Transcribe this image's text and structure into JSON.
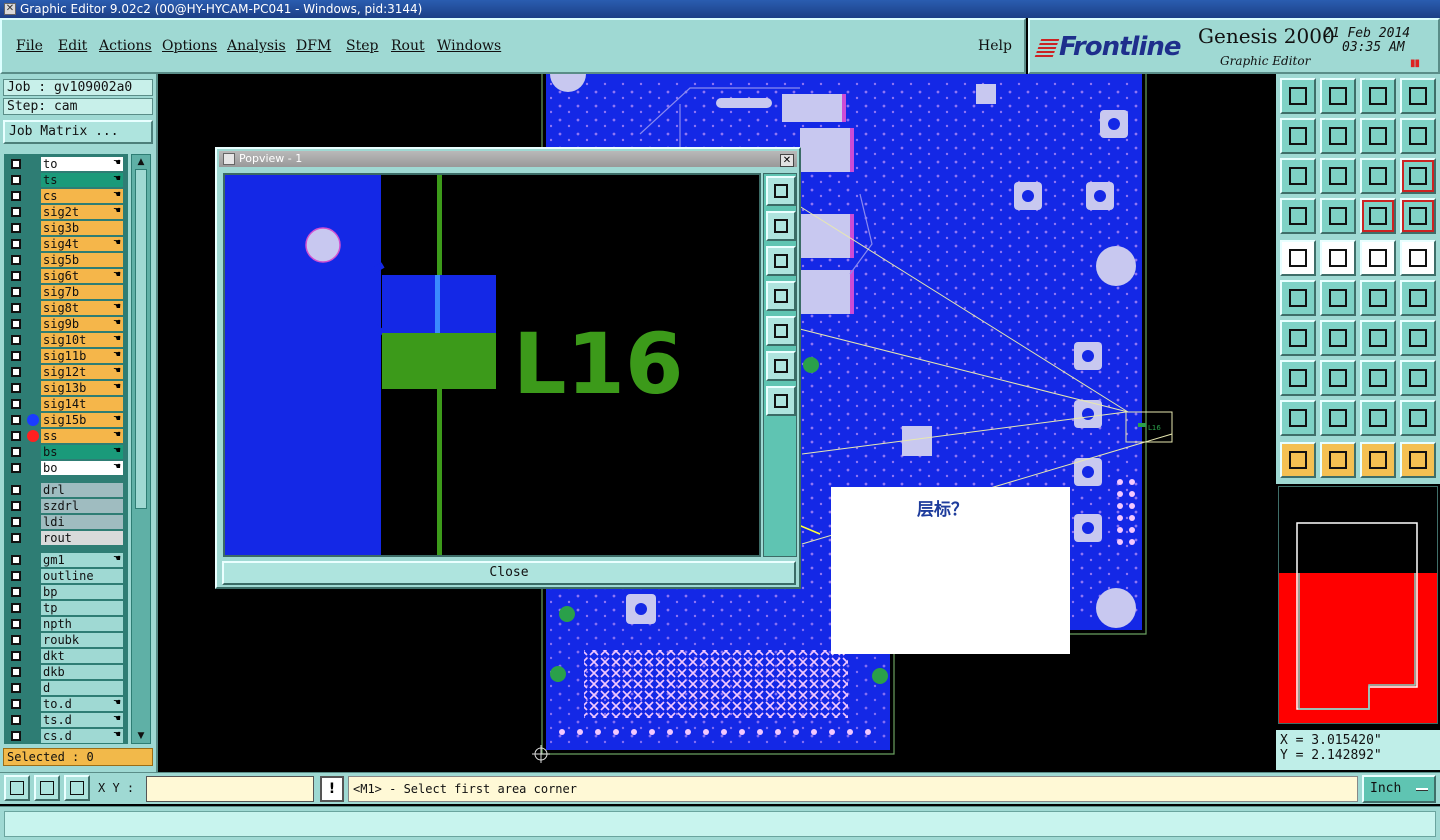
{
  "window": {
    "title": "Graphic Editor 9.02c2 (00@HY-HYCAM-PC041 - Windows, pid:3144)"
  },
  "menu": {
    "items": [
      "File",
      "Edit",
      "Actions",
      "Options",
      "Analysis",
      "DFM",
      "Step",
      "Rout",
      "Windows"
    ],
    "help": "Help"
  },
  "brand": {
    "logo": "Frontline",
    "product": "Genesis 2000",
    "subtitle": "Graphic Editor",
    "date": "21 Feb 2014",
    "time": "03:35 AM"
  },
  "job": {
    "job_label": "Job : gv109002a0",
    "step_label": "Step: cam",
    "matrix_button": "Job Matrix ..."
  },
  "layers": [
    {
      "name": "to",
      "color": "#ffffff",
      "hand": true
    },
    {
      "name": "ts",
      "color": "#1a9a7a",
      "hand": true
    },
    {
      "name": "cs",
      "color": "#f5b64a",
      "hand": true
    },
    {
      "name": "sig2t",
      "color": "#f5b64a",
      "hand": true
    },
    {
      "name": "sig3b",
      "color": "#f5b64a",
      "hand": false
    },
    {
      "name": "sig4t",
      "color": "#f5b64a",
      "hand": true
    },
    {
      "name": "sig5b",
      "color": "#f5b64a",
      "hand": false
    },
    {
      "name": "sig6t",
      "color": "#f5b64a",
      "hand": true
    },
    {
      "name": "sig7b",
      "color": "#f5b64a",
      "hand": false
    },
    {
      "name": "sig8t",
      "color": "#f5b64a",
      "hand": true
    },
    {
      "name": "sig9b",
      "color": "#f5b64a",
      "hand": true
    },
    {
      "name": "sig10t",
      "color": "#f5b64a",
      "hand": true
    },
    {
      "name": "sig11b",
      "color": "#f5b64a",
      "hand": true
    },
    {
      "name": "sig12t",
      "color": "#f5b64a",
      "hand": true
    },
    {
      "name": "sig13b",
      "color": "#f5b64a",
      "hand": true
    },
    {
      "name": "sig14t",
      "color": "#f5b64a",
      "hand": false
    },
    {
      "name": "sig15b",
      "color": "#f5b64a",
      "hand": true,
      "dot": "#1a3cff"
    },
    {
      "name": "ss",
      "color": "#f5b64a",
      "hand": true,
      "dot": "#ff2020"
    },
    {
      "name": "bs",
      "color": "#1a9a7a",
      "hand": true
    },
    {
      "name": "bo",
      "color": "#ffffff",
      "hand": true
    },
    {
      "gap": true
    },
    {
      "name": "drl",
      "color": "#9fbcc0",
      "hand": false
    },
    {
      "name": "szdrl",
      "color": "#9fbcc0",
      "hand": false
    },
    {
      "name": "ldi",
      "color": "#9fbcc0",
      "hand": false
    },
    {
      "name": "rout",
      "color": "#d8dada",
      "hand": false
    },
    {
      "gap": true
    },
    {
      "name": "gm1",
      "color": "#9fd9d3",
      "hand": true
    },
    {
      "name": "outline",
      "color": "#9fd9d3",
      "hand": false
    },
    {
      "name": "bp",
      "color": "#9fd9d3",
      "hand": false
    },
    {
      "name": "tp",
      "color": "#9fd9d3",
      "hand": false
    },
    {
      "name": "npth",
      "color": "#9fd9d3",
      "hand": false
    },
    {
      "name": "roubk",
      "color": "#9fd9d3",
      "hand": false
    },
    {
      "name": "dkt",
      "color": "#9fd9d3",
      "hand": false
    },
    {
      "name": "dkb",
      "color": "#9fd9d3",
      "hand": false
    },
    {
      "name": "d",
      "color": "#9fd9d3",
      "hand": false
    },
    {
      "name": "to.d",
      "color": "#9fd9d3",
      "hand": true
    },
    {
      "name": "ts.d",
      "color": "#9fd9d3",
      "hand": true
    },
    {
      "name": "cs.d",
      "color": "#9fd9d3",
      "hand": true
    }
  ],
  "selected": "Selected : 0",
  "popview": {
    "title": "Popview - 1",
    "close_label": "Close",
    "silk_text": "L16"
  },
  "note": {
    "text": "层标？"
  },
  "coords": {
    "x": "X = 3.015420\"",
    "y": "Y = 2.142892\""
  },
  "bottom": {
    "xy_label": "X Y :",
    "xy_value": "",
    "prompt": "<M1> - Select first area corner",
    "units": "Inch"
  }
}
